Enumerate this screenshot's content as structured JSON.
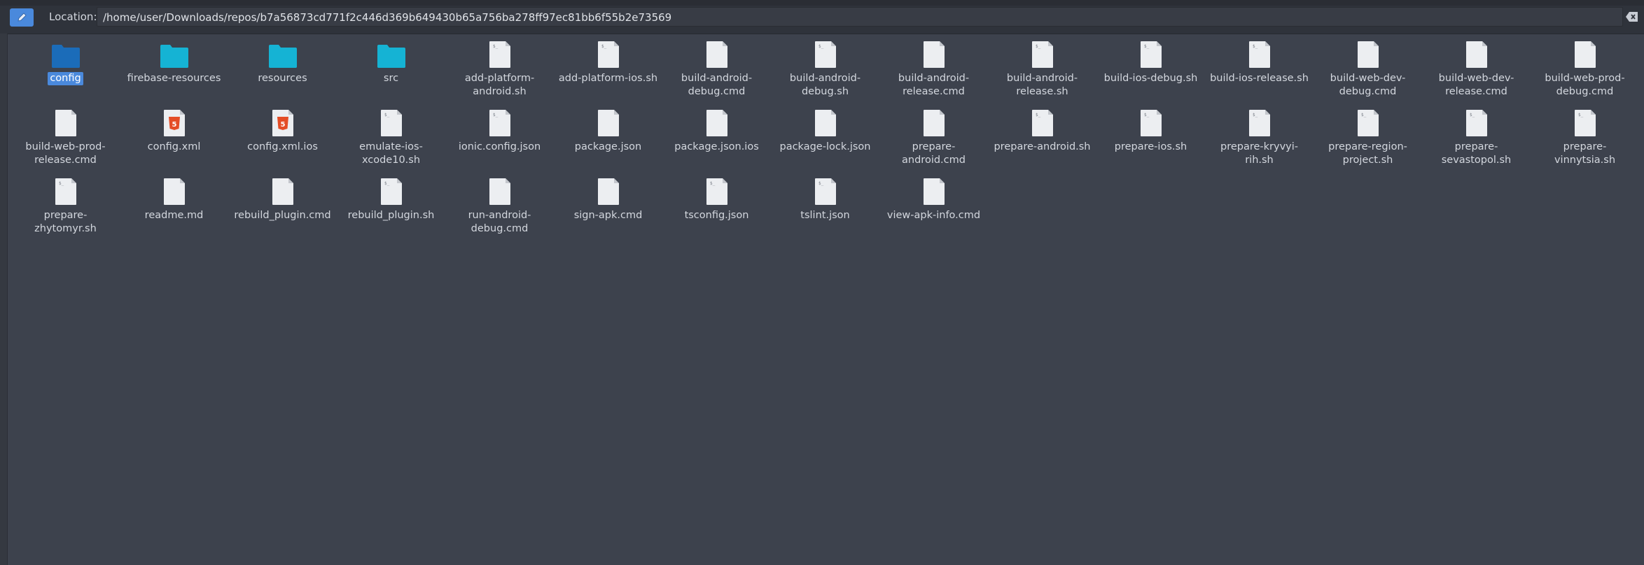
{
  "location": {
    "label": "Location:",
    "path": "/home/user/Downloads/repos/b7a56873cd771f2c446d369b649430b65a756ba278ff97ec81bb6f55b2e73569"
  },
  "colors": {
    "folder_selected": "#1b6cb9",
    "folder": "#16b3d4",
    "html5": "#e44d26",
    "accent": "#4a89dc"
  },
  "files": [
    {
      "name": "config",
      "type": "folder",
      "selected": true
    },
    {
      "name": "firebase-resources",
      "type": "folder"
    },
    {
      "name": "resources",
      "type": "folder"
    },
    {
      "name": "src",
      "type": "folder"
    },
    {
      "name": "add-platform-android.sh",
      "type": "script"
    },
    {
      "name": "add-platform-ios.sh",
      "type": "script"
    },
    {
      "name": "build-android-debug.cmd",
      "type": "file"
    },
    {
      "name": "build-android-debug.sh",
      "type": "script"
    },
    {
      "name": "build-android-release.cmd",
      "type": "file"
    },
    {
      "name": "build-android-release.sh",
      "type": "script"
    },
    {
      "name": "build-ios-debug.sh",
      "type": "script"
    },
    {
      "name": "build-ios-release.sh",
      "type": "script"
    },
    {
      "name": "build-web-dev-debug.cmd",
      "type": "file"
    },
    {
      "name": "build-web-dev-release.cmd",
      "type": "file"
    },
    {
      "name": "build-web-prod-debug.cmd",
      "type": "file"
    },
    {
      "name": "build-web-prod-release.cmd",
      "type": "file"
    },
    {
      "name": "config.xml",
      "type": "html5"
    },
    {
      "name": "config.xml.ios",
      "type": "html5"
    },
    {
      "name": "emulate-ios-xcode10.sh",
      "type": "script"
    },
    {
      "name": "ionic.config.json",
      "type": "script"
    },
    {
      "name": "package.json",
      "type": "file"
    },
    {
      "name": "package.json.ios",
      "type": "file"
    },
    {
      "name": "package-lock.json",
      "type": "file"
    },
    {
      "name": "prepare-android.cmd",
      "type": "file"
    },
    {
      "name": "prepare-android.sh",
      "type": "script"
    },
    {
      "name": "prepare-ios.sh",
      "type": "script"
    },
    {
      "name": "prepare-kryvyi-rih.sh",
      "type": "script"
    },
    {
      "name": "prepare-region-project.sh",
      "type": "script"
    },
    {
      "name": "prepare-sevastopol.sh",
      "type": "script"
    },
    {
      "name": "prepare-vinnytsia.sh",
      "type": "script"
    },
    {
      "name": "prepare-zhytomyr.sh",
      "type": "script"
    },
    {
      "name": "readme.md",
      "type": "file"
    },
    {
      "name": "rebuild_plugin.cmd",
      "type": "file"
    },
    {
      "name": "rebuild_plugin.sh",
      "type": "script"
    },
    {
      "name": "run-android-debug.cmd",
      "type": "file"
    },
    {
      "name": "sign-apk.cmd",
      "type": "file"
    },
    {
      "name": "tsconfig.json",
      "type": "script"
    },
    {
      "name": "tslint.json",
      "type": "script"
    },
    {
      "name": "view-apk-info.cmd",
      "type": "file"
    }
  ]
}
